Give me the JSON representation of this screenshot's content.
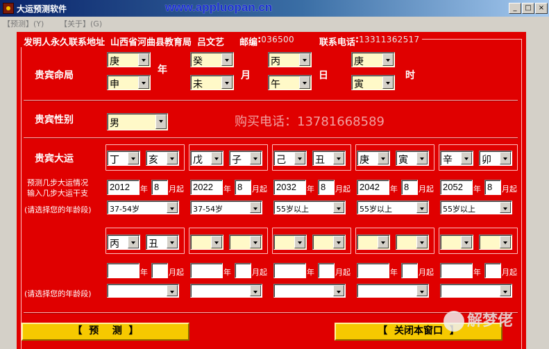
{
  "window": {
    "title": "大运预测软件",
    "url_overlay": "www.appluopan.cn"
  },
  "menu": [
    {
      "label": "【预测】(Y)"
    },
    {
      "label": "【关于】(G)"
    }
  ],
  "info": {
    "inventor_label": "发明人永久联系地址",
    "address": "山西省河曲县教育局",
    "name": "吕文艺",
    "zip_label": "邮编",
    "zip": "036500",
    "phone_label": "联系电话",
    "phone": "13311362517"
  },
  "mingju": {
    "label": "贵宾命局",
    "year": {
      "stem": "庚",
      "branch": "申",
      "unit": "年"
    },
    "month": {
      "stem": "癸",
      "branch": "未",
      "unit": "月"
    },
    "day": {
      "stem": "丙",
      "branch": "午",
      "unit": "日"
    },
    "hour": {
      "stem": "庚",
      "branch": "寅",
      "unit": "时"
    }
  },
  "gender": {
    "label": "贵宾性别",
    "value": "男"
  },
  "buy_phone": "购买电话：13781668589",
  "dayun": {
    "label": "贵宾大运",
    "prompt_line1": "预测几步大运情况",
    "prompt_line2": "输入几步大运干支",
    "age_prompt": "(请选择您的年龄段)",
    "year_unit": "年",
    "month_unit": "月起",
    "row1": [
      {
        "stem": "丁",
        "branch": "亥",
        "year": "2012",
        "month": "8",
        "age": "37-54岁"
      },
      {
        "stem": "戊",
        "branch": "子",
        "year": "2022",
        "month": "8",
        "age": "37-54岁"
      },
      {
        "stem": "己",
        "branch": "丑",
        "year": "2032",
        "month": "8",
        "age": "55岁以上"
      },
      {
        "stem": "庚",
        "branch": "寅",
        "year": "2042",
        "month": "8",
        "age": "55岁以上"
      },
      {
        "stem": "辛",
        "branch": "卯",
        "year": "2052",
        "month": "8",
        "age": "55岁以上"
      }
    ],
    "row2": [
      {
        "stem": "丙",
        "branch": "丑",
        "year": "",
        "month": "",
        "age": ""
      },
      {
        "stem": "",
        "branch": "",
        "year": "",
        "month": "",
        "age": ""
      },
      {
        "stem": "",
        "branch": "",
        "year": "",
        "month": "",
        "age": ""
      },
      {
        "stem": "",
        "branch": "",
        "year": "",
        "month": "",
        "age": ""
      },
      {
        "stem": "",
        "branch": "",
        "year": "",
        "month": "",
        "age": ""
      }
    ]
  },
  "buttons": {
    "predict": "【  预    测  】",
    "close": "【  关闭本窗口  】"
  },
  "watermark": "解梦佬",
  "colors": {
    "panel": "#e00000",
    "button": "#f6c900",
    "input_yellow": "#fff9c8",
    "titlebar": "#0a246a"
  }
}
